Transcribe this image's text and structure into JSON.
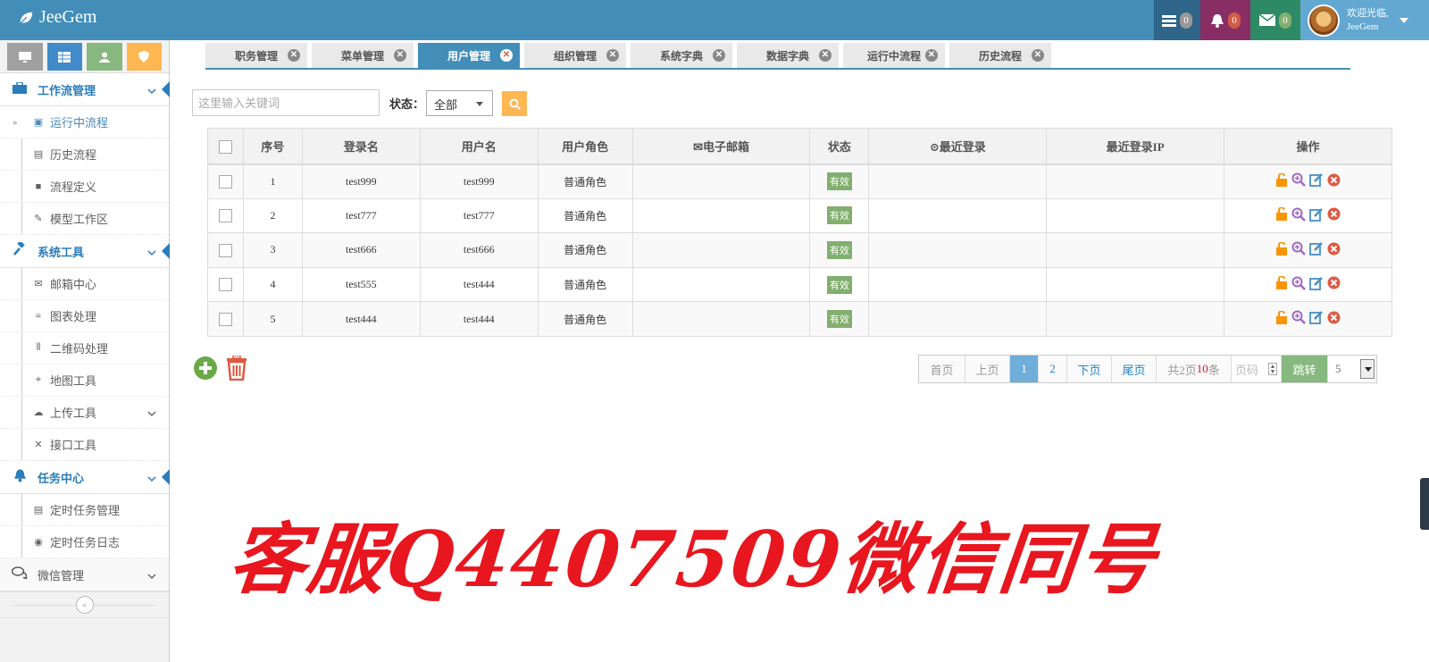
{
  "app": {
    "brand": "JeeGem"
  },
  "navbar": {
    "tasks_count": "0",
    "notifications_count": "0",
    "messages_count": "0",
    "user_greeting": "欢迎光临,",
    "user_name": "JeeGem"
  },
  "sidebar": {
    "groups": [
      {
        "label": "工作流管理",
        "items": [
          "运行中流程",
          "历史流程",
          "流程定义",
          "模型工作区"
        ]
      },
      {
        "label": "系统工具",
        "items": [
          "邮箱中心",
          "图表处理",
          "二维码处理",
          "地图工具",
          "上传工具",
          "接口工具"
        ]
      },
      {
        "label": "任务中心",
        "items": [
          "定时任务管理",
          "定时任务日志"
        ]
      },
      {
        "label": "微信管理"
      }
    ]
  },
  "tabs": [
    "职务管理",
    "菜单管理",
    "用户管理",
    "组织管理",
    "系统字典",
    "数据字典",
    "运行中流程",
    "历史流程"
  ],
  "search": {
    "placeholder": "这里输入关键词",
    "status_label": "状态：",
    "status_value": "全部"
  },
  "table": {
    "headers": [
      "序号",
      "登录名",
      "用户名",
      "用户角色",
      "电子邮箱",
      "状态",
      "最近登录",
      "最近登录IP",
      "操作"
    ],
    "rows": [
      {
        "no": "1",
        "login": "test999",
        "name": "test999",
        "role": "普通角色",
        "email": "",
        "status": "有效",
        "last_login": "",
        "last_ip": ""
      },
      {
        "no": "2",
        "login": "test777",
        "name": "test777",
        "role": "普通角色",
        "email": "",
        "status": "有效",
        "last_login": "",
        "last_ip": ""
      },
      {
        "no": "3",
        "login": "test666",
        "name": "test666",
        "role": "普通角色",
        "email": "",
        "status": "有效",
        "last_login": "",
        "last_ip": ""
      },
      {
        "no": "4",
        "login": "test555",
        "name": "test444",
        "role": "普通角色",
        "email": "",
        "status": "有效",
        "last_login": "",
        "last_ip": ""
      },
      {
        "no": "5",
        "login": "test444",
        "name": "test444",
        "role": "普通角色",
        "email": "",
        "status": "有效",
        "last_login": "",
        "last_ip": ""
      }
    ]
  },
  "pager": {
    "first": "首页",
    "prev": "上页",
    "page1": "1",
    "page2": "2",
    "next": "下页",
    "last": "尾页",
    "total_prefix": "共2页",
    "total_count": "10",
    "total_suffix": "条",
    "page_placeholder": "页码",
    "go": "跳转",
    "page_size": "5"
  },
  "watermark": "客服Q4407509微信同号",
  "colors": {
    "navbar": "#438eb9",
    "accent_text": "#2b7dbc",
    "status_badge": "#82af6f",
    "go_button": "#87b87f",
    "watermark": "#e8161f"
  }
}
